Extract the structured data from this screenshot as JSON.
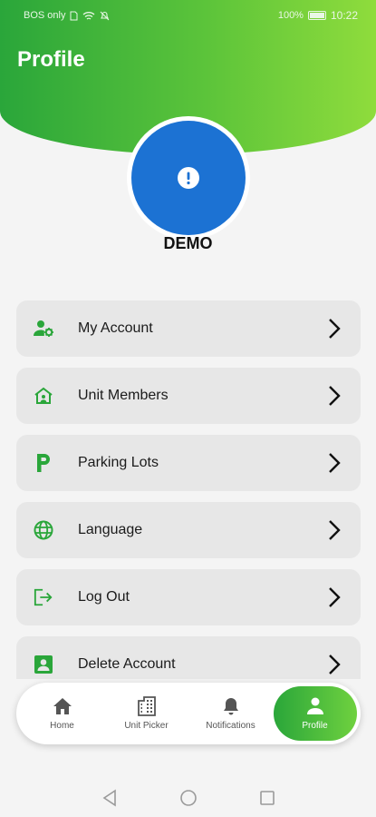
{
  "status_bar": {
    "carrier": "BOS only",
    "battery": "100%",
    "time": "10:22"
  },
  "header": {
    "title": "Profile"
  },
  "profile": {
    "username": "DEMO",
    "avatar_icon": "alert-circle-icon",
    "avatar_color": "#1c72d3"
  },
  "menu": {
    "items": [
      {
        "label": "My Account",
        "icon": "account-settings-icon"
      },
      {
        "label": "Unit Members",
        "icon": "home-users-icon"
      },
      {
        "label": "Parking Lots",
        "icon": "parking-icon"
      },
      {
        "label": "Language",
        "icon": "globe-icon"
      },
      {
        "label": "Log Out",
        "icon": "logout-icon"
      },
      {
        "label": "Delete Account",
        "icon": "account-box-icon"
      }
    ]
  },
  "tabbar": {
    "tabs": [
      {
        "label": "Home",
        "icon": "home-icon"
      },
      {
        "label": "Unit Picker",
        "icon": "building-icon"
      },
      {
        "label": "Notifications",
        "icon": "bell-icon"
      },
      {
        "label": "Profile",
        "icon": "person-icon",
        "active": true
      }
    ]
  },
  "colors": {
    "accent_green": "#2aa63a",
    "accent_green_light": "#8fdc3c"
  }
}
